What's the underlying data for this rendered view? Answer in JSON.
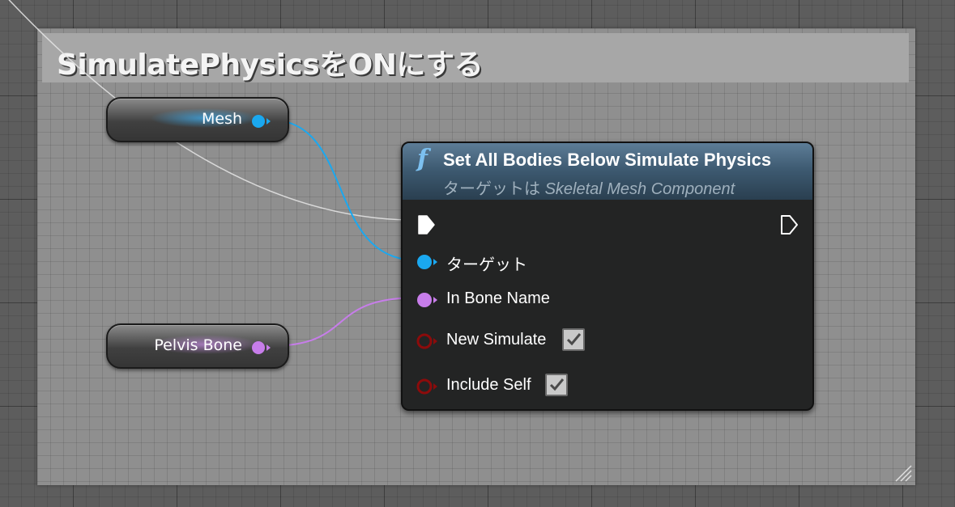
{
  "comment": {
    "title": "SimulatePhysicsをONにする"
  },
  "variables": {
    "mesh": {
      "label": "Mesh",
      "pin_color": "#1aa8f0"
    },
    "pelvis": {
      "label": "Pelvis Bone",
      "pin_color": "#c77dea"
    }
  },
  "function_node": {
    "icon": "f",
    "title": "Set All Bodies Below Simulate Physics",
    "subtitle_prefix": "ターゲットは",
    "subtitle_class": "Skeletal Mesh Component",
    "pins": {
      "exec_in": "exec-in-pin",
      "exec_out": "exec-out-pin",
      "target": {
        "label": "ターゲット"
      },
      "in_bone_name": {
        "label": "In Bone Name"
      },
      "new_simulate": {
        "label": "New Simulate",
        "checked": true
      },
      "include_self": {
        "label": "Include Self",
        "checked": true
      }
    }
  },
  "colors": {
    "object_pin": "#1aa8f0",
    "name_pin": "#c77dea",
    "bool_pin": "#8c0b0b",
    "exec_pin": "#ffffff",
    "exec_wire": "#e6e6e6",
    "header": "#3e5b72"
  }
}
